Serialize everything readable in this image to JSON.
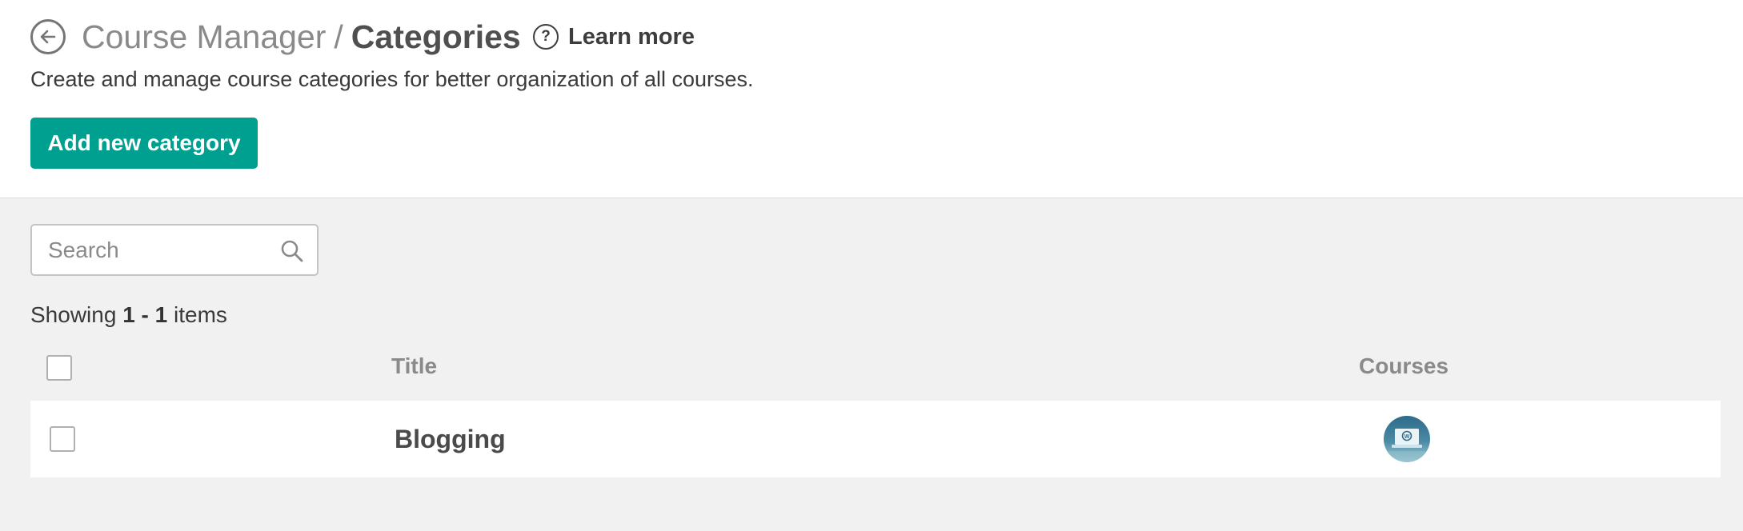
{
  "header": {
    "breadcrumb_parent": "Course Manager",
    "breadcrumb_separator": "/",
    "page_title": "Categories",
    "learn_more_label": "Learn more",
    "description": "Create and manage course categories for better organization of all courses.",
    "add_button_label": "Add new category"
  },
  "search": {
    "placeholder": "Search",
    "value": ""
  },
  "listing": {
    "showing_prefix": "Showing",
    "range": "1 - 1",
    "showing_suffix": "items"
  },
  "table": {
    "columns": {
      "title": "Title",
      "courses": "Courses"
    },
    "rows": [
      {
        "title": "Blogging",
        "courses_thumbnail_icon": "wordpress-icon",
        "selected": false
      }
    ]
  },
  "colors": {
    "accent": "#00a091",
    "page_background": "#f1f1f1",
    "header_background": "#ffffff"
  },
  "icons": {
    "back": "arrow-left-circle-icon",
    "help": "question-circle-icon",
    "search": "magnifier-icon"
  }
}
